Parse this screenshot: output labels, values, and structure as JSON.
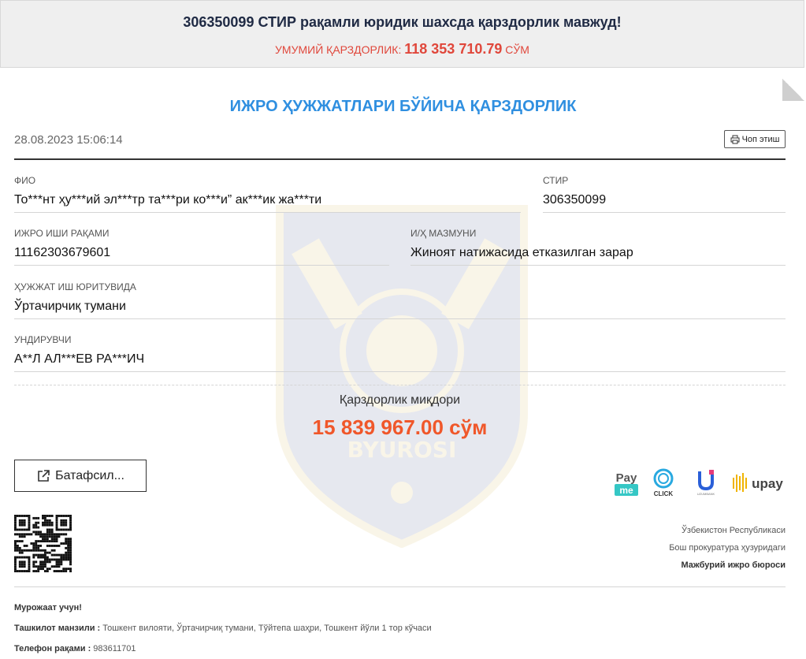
{
  "banner": {
    "headline": "306350099 СТИР рақамли юридик шахсда қарздорлик мавжуд!",
    "total_label": "Умумий қарздорлик:",
    "total_amount": "118 353 710.79",
    "total_currency": "СЎМ"
  },
  "document": {
    "title": "ИЖРО ҲУЖЖАТЛАРИ БЎЙИЧА ҚАРЗДОРЛИК",
    "timestamp": "28.08.2023 15:06:14",
    "print_label": "Чоп этиш",
    "fields": {
      "fio_label": "ФИО",
      "fio_value": "То***нт ҳу***ий эл***тр та***ри ко***и” ак***ик жа***ти",
      "stir_label": "СТИР",
      "stir_value": "306350099",
      "case_number_label": "Ижро иши рақами",
      "case_number_value": "11162303679601",
      "subject_label": "И/Ҳ мазмуни",
      "subject_value": "Жиноят натижасида етказилган зарар",
      "proceeding_label": "Ҳужжат иш юритувида",
      "proceeding_value": "Ўртачирчиқ тумани",
      "collector_label": "Ундирувчи",
      "collector_value": "А**Л АЛ***ЕВ РА***ИЧ"
    },
    "debt_label": "Қарздорлик миқдори",
    "debt_amount": "15 839 967.00 сўм",
    "details_label": "Батафсил...",
    "payments": {
      "payme_top": "Pay",
      "payme_bottom": "me",
      "click": "CLICK",
      "uzum": "UZUMBANK",
      "upay": "upay"
    },
    "watermark_text": "BYUROSI",
    "org": {
      "line1": "Ўзбекистон Республикаси",
      "line2": "Бош прокуратура ҳузуридаги",
      "line3": "Мажбурий ижро бюроси"
    },
    "footer": {
      "contact_heading": "Мурожаат учун!",
      "address_label": "Ташкилот манзили :",
      "address_value": "Тошкент вилояти, Ўртачирчиқ тумани, Тўйтепа шаҳри, Тошкент йўли 1 тор кўчаси",
      "phone_label": "Телефон рақами :",
      "phone_value": "983611701"
    }
  },
  "colors": {
    "title_blue": "#2f8fe0",
    "debt_orange": "#f0572a",
    "banner_red": "#e0473b",
    "banner_navy": "#1f2a44"
  }
}
